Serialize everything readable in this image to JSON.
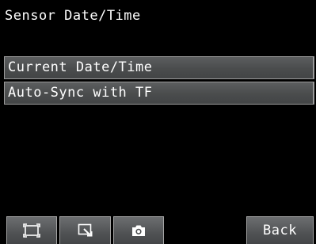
{
  "header": {
    "title": "Sensor Date/Time"
  },
  "menu": {
    "items": [
      {
        "label": "Current Date/Time"
      },
      {
        "label": "Auto-Sync with TF"
      }
    ]
  },
  "toolbar": {
    "fit_icon": "fit-frame-icon",
    "zoom_icon": "zoom-icon",
    "capture_icon": "camera-icon",
    "back_label": "Back"
  },
  "colors": {
    "background": "#000000",
    "item_bg": "#4d4f50",
    "text": "#ffffff"
  }
}
